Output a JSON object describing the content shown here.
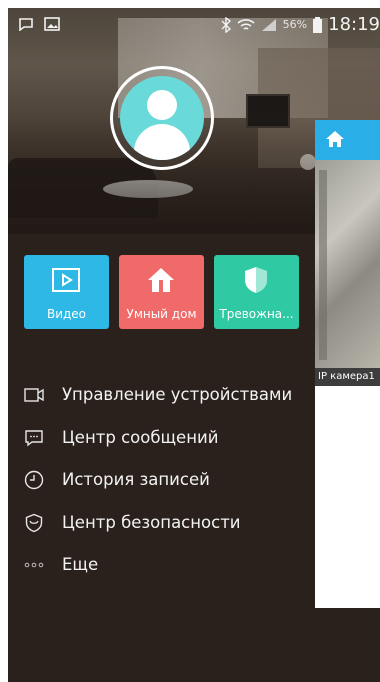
{
  "status_bar": {
    "battery_percent": "56%",
    "time": "18:19",
    "icons": [
      "notification-icon",
      "gallery-icon",
      "bluetooth-icon",
      "wifi-icon",
      "signal-icon",
      "battery-icon"
    ]
  },
  "profile": {
    "avatar_icon": "user-avatar-icon"
  },
  "tiles": [
    {
      "label": "Видео",
      "icon": "video-play-icon",
      "color": "#2eb8e6"
    },
    {
      "label": "Умный дом",
      "icon": "home-icon",
      "color": "#f06a6a"
    },
    {
      "label": "Тревожна...",
      "icon": "shield-icon",
      "color": "#2fc9a3"
    }
  ],
  "menu": [
    {
      "label": "Управление устройствами",
      "icon": "camera-icon"
    },
    {
      "label": "Центр сообщений",
      "icon": "message-icon"
    },
    {
      "label": "История записей",
      "icon": "history-icon"
    },
    {
      "label": "Центр безопасности",
      "icon": "shield-outline-icon"
    },
    {
      "label": "Еще",
      "icon": "more-icon"
    }
  ],
  "side_panel": {
    "home_icon": "home-icon",
    "camera_label": "IP камера1",
    "accent": "#2aaee7"
  }
}
